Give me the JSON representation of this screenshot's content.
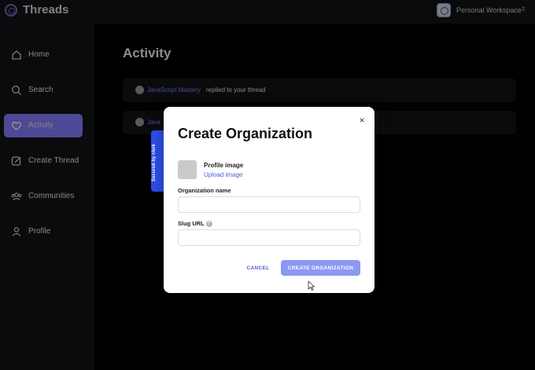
{
  "app": {
    "title": "Threads"
  },
  "workspace": {
    "name": "Personal Workspace"
  },
  "sidebar": {
    "items": [
      {
        "label": "Home",
        "icon": "home-icon",
        "active": false
      },
      {
        "label": "Search",
        "icon": "search-icon",
        "active": false
      },
      {
        "label": "Activity",
        "icon": "heart-icon",
        "active": true
      },
      {
        "label": "Create Thread",
        "icon": "create-thread-icon",
        "active": false
      },
      {
        "label": "Communities",
        "icon": "communities-icon",
        "active": false
      },
      {
        "label": "Profile",
        "icon": "profile-icon",
        "active": false
      }
    ]
  },
  "page": {
    "title": "Activity",
    "activity": [
      {
        "user": "JavaScript Mastery",
        "text": "replied to your thread"
      },
      {
        "user": "Java",
        "text": ""
      }
    ]
  },
  "clerk_badge": {
    "text": "Secured by  clerk"
  },
  "modal": {
    "title": "Create Organization",
    "close": "×",
    "profile_image_label": "Profile image",
    "upload_label": "Upload image",
    "org_name_label": "Organization name",
    "org_name_value": "",
    "slug_label": "Slug URL",
    "slug_help": "?",
    "slug_value": "",
    "cancel_label": "CANCEL",
    "create_label": "CREATE ORGANIZATION"
  },
  "colors": {
    "accent": "#877eff",
    "clerk_blue": "#2e50ef",
    "primary_button": "#8d98f4"
  }
}
